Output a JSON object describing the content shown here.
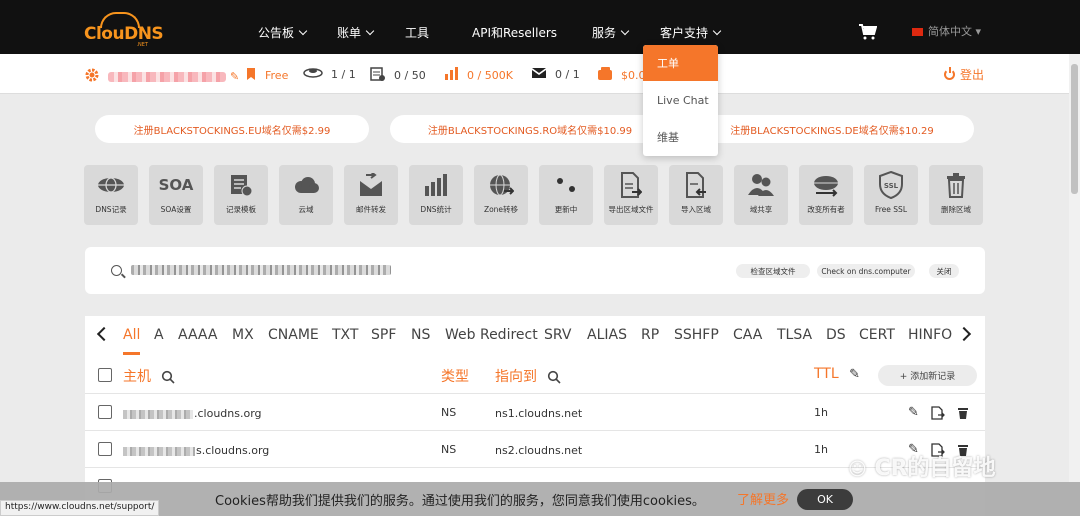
{
  "brand": {
    "logo_text": "ClouDNS",
    "logo_sub": ".NET"
  },
  "nav": {
    "items": [
      {
        "label": "公告板",
        "dropdown": true
      },
      {
        "label": "账单",
        "dropdown": true
      },
      {
        "label": "工具",
        "dropdown": false
      },
      {
        "label": "API和Resellers",
        "dropdown": false
      },
      {
        "label": "服务",
        "dropdown": true
      },
      {
        "label": "客户支持",
        "dropdown": true
      }
    ],
    "language": "简体中文"
  },
  "support_menu": {
    "items": [
      "工单",
      "Live Chat",
      "维基"
    ],
    "active": "工单"
  },
  "status": {
    "plan": "Free",
    "zones": "1 / 1",
    "records": "0 / 50",
    "queries": "0 / 500K",
    "mail_forwards": "0 / 1",
    "balance": "$0.0",
    "logout": "登出"
  },
  "promos": [
    "注册BLACKSTOCKINGS.EU域名仅需$2.99",
    "注册BLACKSTOCKINGS.RO域名仅需$10.99",
    "注册BLACKSTOCKINGS.DE域名仅需$10.29"
  ],
  "tools": [
    {
      "label": "DNS记录",
      "icon": "globe-icon"
    },
    {
      "label": "SOA设置",
      "icon": "soa-icon",
      "glyph": "SOA"
    },
    {
      "label": "记录模板",
      "icon": "template-icon"
    },
    {
      "label": "云域",
      "icon": "cloud-icon"
    },
    {
      "label": "邮件转发",
      "icon": "mail-forward-icon"
    },
    {
      "label": "DNS统计",
      "icon": "bar-chart-icon"
    },
    {
      "label": "Zone转移",
      "icon": "zone-transfer-icon"
    },
    {
      "label": "更新中",
      "icon": "dots-icon"
    },
    {
      "label": "导出区域文件",
      "icon": "export-file-icon"
    },
    {
      "label": "导入区域",
      "icon": "import-file-icon"
    },
    {
      "label": "域共享",
      "icon": "users-icon"
    },
    {
      "label": "改变所有者",
      "icon": "change-owner-icon"
    },
    {
      "label": "Free SSL",
      "icon": "ssl-shield-icon",
      "glyph": "SSL"
    },
    {
      "label": "删除区域",
      "icon": "trash-icon"
    }
  ],
  "search_bar": {
    "buttons": [
      "检查区域文件",
      "Check on dns.computer",
      "关闭"
    ]
  },
  "record_tabs": {
    "items": [
      "All",
      "A",
      "AAAA",
      "MX",
      "CNAME",
      "TXT",
      "SPF",
      "NS",
      "Web Redirect",
      "SRV",
      "ALIAS",
      "RP",
      "SSHFP",
      "CAA",
      "TLSA",
      "DS",
      "CERT",
      "HINFO"
    ],
    "active": "All"
  },
  "records_table": {
    "headers": {
      "host": "主机",
      "type": "类型",
      "points_to": "指向到",
      "ttl": "TTL"
    },
    "add_button": "+ 添加新记录",
    "rows": [
      {
        "host_suffix": ".cloudns.org",
        "type": "NS",
        "points_to": "ns1.cloudns.net",
        "ttl": "1h"
      },
      {
        "host_suffix": "s.cloudns.org",
        "type": "NS",
        "points_to": "ns2.cloudns.net",
        "ttl": "1h"
      }
    ]
  },
  "cookie_bar": {
    "text": "Cookies帮助我们提供我们的服务。通过使用我们的服务，您同意我们使用cookies。",
    "more": "了解更多",
    "ok": "OK"
  },
  "status_url": "https://www.cloudns.net/support/",
  "watermark": "CR的自留地",
  "colors": {
    "accent": "#f5762a",
    "nav_bg": "#111111",
    "page_bg": "#ebebeb"
  }
}
